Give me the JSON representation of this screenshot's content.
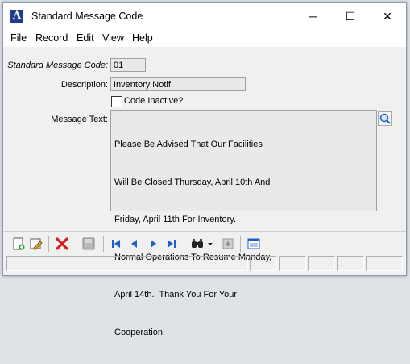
{
  "window": {
    "title": "Standard Message Code",
    "app_icon_glyph": "Λ",
    "minimize_glyph": "─",
    "maximize_glyph": "☐",
    "close_glyph": "✕"
  },
  "menu": {
    "items": [
      "File",
      "Record",
      "Edit",
      "View",
      "Help"
    ]
  },
  "form": {
    "code_label": "Standard Message Code:",
    "code_value": "01",
    "description_label": "Description:",
    "description_value": "Inventory Notif.",
    "inactive_label": "Code Inactive?",
    "inactive_checked": false,
    "message_label": "Message Text:",
    "message_lines": [
      "Please Be Advised That Our Facilities",
      "Will Be Closed Thursday, April 10th And",
      "Friday, April 11th For Inventory.",
      "Normal Operations To Resume Monday,",
      "April 14th.  Thank You For Your",
      "Cooperation."
    ]
  },
  "toolbar": {
    "icons": [
      "new-record-icon",
      "edit-icon",
      "delete-icon",
      "save-icon",
      "first-record-icon",
      "previous-record-icon",
      "next-record-icon",
      "last-record-icon",
      "find-icon",
      "find-dropdown-icon",
      "print-icon",
      "layout-icon"
    ]
  },
  "colors": {
    "accent": "#1f3f8a",
    "delete": "#d42020",
    "nav": "#1f5fc8"
  }
}
